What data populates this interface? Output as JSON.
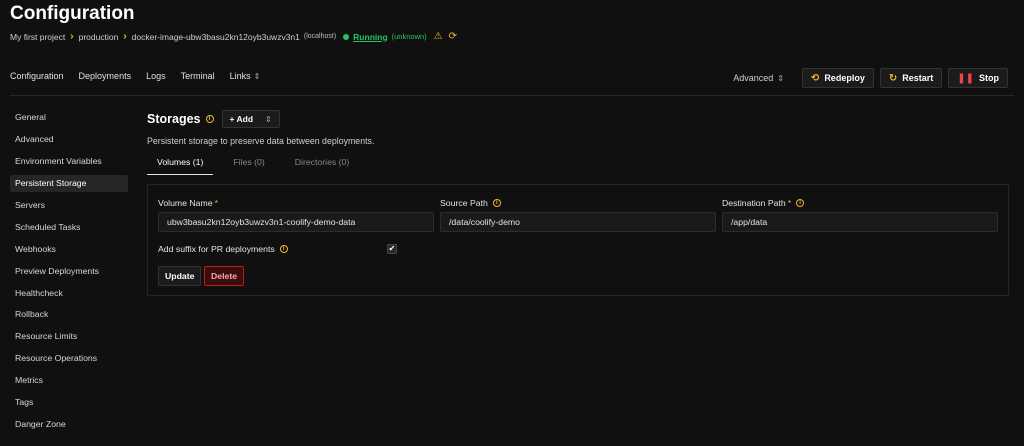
{
  "page": {
    "title": "Configuration"
  },
  "breadcrumb": {
    "project": "My first project",
    "environment": "production",
    "resource": "docker-image-ubw3basu2kn12oyb3uwzv3n1",
    "host": "(localhost)",
    "status": "Running",
    "status_detail": "(unknown)"
  },
  "topnav": {
    "items": [
      "Configuration",
      "Deployments",
      "Logs",
      "Terminal",
      "Links"
    ]
  },
  "actions": {
    "advanced": "Advanced",
    "redeploy": "Redeploy",
    "restart": "Restart",
    "stop": "Stop"
  },
  "sidebar": {
    "items": [
      "General",
      "Advanced",
      "Environment Variables",
      "Persistent Storage",
      "Servers",
      "Scheduled Tasks",
      "Webhooks",
      "Preview Deployments",
      "Healthcheck",
      "Rollback",
      "Resource Limits",
      "Resource Operations",
      "Metrics",
      "Tags",
      "Danger Zone"
    ],
    "active": "Persistent Storage"
  },
  "storages": {
    "title": "Storages",
    "add_label": "+ Add",
    "subtitle": "Persistent storage to preserve data between deployments.",
    "tabs": [
      "Volumes (1)",
      "Files (0)",
      "Directories (0)"
    ],
    "volume": {
      "name_label": "Volume Name",
      "name_value": "ubw3basu2kn12oyb3uwzv3n1-coolify-demo-data",
      "source_label": "Source Path",
      "source_value": "/data/coolify-demo",
      "dest_label": "Destination Path",
      "dest_value": "/app/data",
      "suffix_label": "Add suffix for PR deployments",
      "suffix_checked": true,
      "update_label": "Update",
      "delete_label": "Delete"
    }
  },
  "colors": {
    "accent": "#f5b730",
    "running": "#22c55e",
    "danger": "#ef4444",
    "background": "#101010"
  }
}
